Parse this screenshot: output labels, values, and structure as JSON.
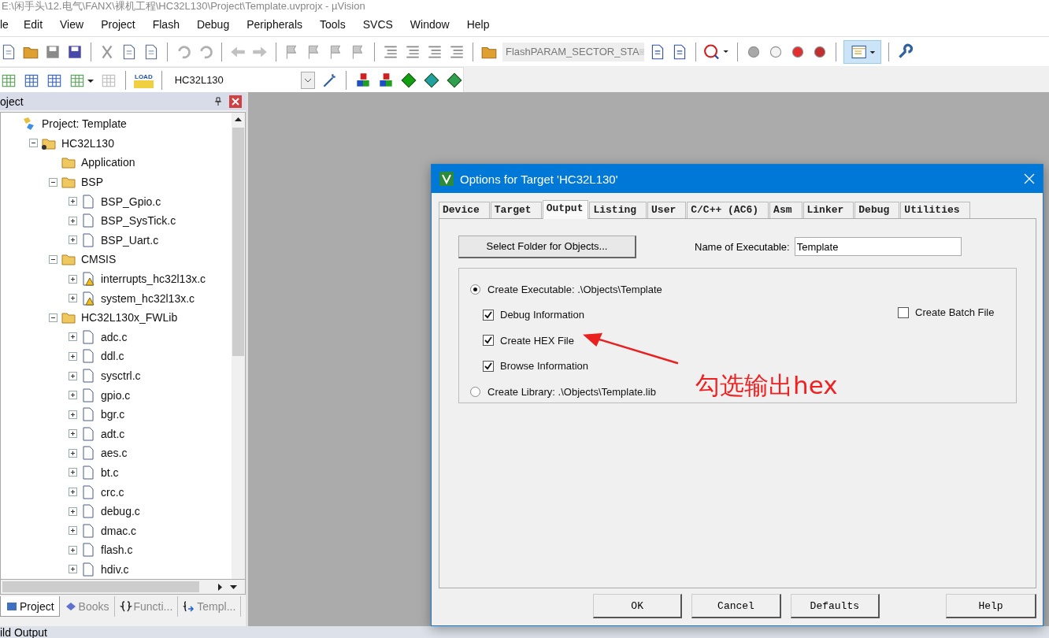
{
  "window": {
    "title": "E:\\闲手头\\12.电气\\FANX\\裸机工程\\HC32L130\\Project\\Template.uvprojx - µVision"
  },
  "menu": [
    "le",
    "Edit",
    "View",
    "Project",
    "Flash",
    "Debug",
    "Peripherals",
    "Tools",
    "SVCS",
    "Window",
    "Help"
  ],
  "toolbar": {
    "flash_combo": "FlashPARAM_SECTOR_STA",
    "load_label": "LOAD",
    "target_combo": "HC32L130"
  },
  "project_panel": {
    "title": "oject",
    "tree": [
      {
        "label": "Project: Template",
        "kind": "project",
        "children": [
          {
            "label": "HC32L130",
            "kind": "target",
            "expanded": true,
            "children": [
              {
                "label": "Application",
                "kind": "folder"
              },
              {
                "label": "BSP",
                "kind": "folder",
                "expanded": true,
                "children": [
                  {
                    "label": "BSP_Gpio.c",
                    "kind": "file",
                    "expanded": false
                  },
                  {
                    "label": "BSP_SysTick.c",
                    "kind": "file",
                    "expanded": false
                  },
                  {
                    "label": "BSP_Uart.c",
                    "kind": "file",
                    "expanded": false
                  }
                ]
              },
              {
                "label": "CMSIS",
                "kind": "folder",
                "expanded": true,
                "children": [
                  {
                    "label": "interrupts_hc32l13x.c",
                    "kind": "warning-file",
                    "expanded": false
                  },
                  {
                    "label": "system_hc32l13x.c",
                    "kind": "warning-file",
                    "expanded": false
                  }
                ]
              },
              {
                "label": "HC32L130x_FWLib",
                "kind": "folder",
                "expanded": true,
                "children": [
                  {
                    "label": "adc.c",
                    "kind": "file",
                    "expanded": false
                  },
                  {
                    "label": "ddl.c",
                    "kind": "file",
                    "expanded": false
                  },
                  {
                    "label": "sysctrl.c",
                    "kind": "file",
                    "expanded": false
                  },
                  {
                    "label": "gpio.c",
                    "kind": "file",
                    "expanded": false
                  },
                  {
                    "label": "bgr.c",
                    "kind": "file",
                    "expanded": false
                  },
                  {
                    "label": "adt.c",
                    "kind": "file",
                    "expanded": false
                  },
                  {
                    "label": "aes.c",
                    "kind": "file",
                    "expanded": false
                  },
                  {
                    "label": "bt.c",
                    "kind": "file",
                    "expanded": false
                  },
                  {
                    "label": "crc.c",
                    "kind": "file",
                    "expanded": false
                  },
                  {
                    "label": "debug.c",
                    "kind": "file",
                    "expanded": false
                  },
                  {
                    "label": "dmac.c",
                    "kind": "file",
                    "expanded": false
                  },
                  {
                    "label": "flash.c",
                    "kind": "file",
                    "expanded": false
                  },
                  {
                    "label": "hdiv.c",
                    "kind": "file",
                    "expanded": false
                  }
                ]
              }
            ]
          }
        ]
      }
    ],
    "tabs": [
      {
        "label": "Project",
        "kind": "project",
        "selected": true
      },
      {
        "label": "Books",
        "kind": "books",
        "selected": false
      },
      {
        "label": "Functi...",
        "kind": "functions",
        "selected": false
      },
      {
        "label": "Templ...",
        "kind": "templates",
        "selected": false
      }
    ]
  },
  "output_panel": {
    "title": "ild Output"
  },
  "dialog": {
    "title": "Options for Target 'HC32L130'",
    "tabs": [
      {
        "label": "Device",
        "selected": false
      },
      {
        "label": "Target",
        "selected": false
      },
      {
        "label": "Output",
        "selected": true
      },
      {
        "label": "Listing",
        "selected": false
      },
      {
        "label": "User",
        "selected": false
      },
      {
        "label": "C/C++ (AC6)",
        "selected": false
      },
      {
        "label": "Asm",
        "selected": false
      },
      {
        "label": "Linker",
        "selected": false
      },
      {
        "label": "Debug",
        "selected": false
      },
      {
        "label": "Utilities",
        "selected": false
      }
    ],
    "select_folder_button": "Select Folder for Objects...",
    "name_label": "Name of Executable:",
    "name_value": "Template",
    "options": [
      {
        "kind": "radio",
        "label": "Create Executable:  .\\Objects\\Template",
        "selected": true
      },
      {
        "kind": "checkbox",
        "label": "Debug Information",
        "checked": true
      },
      {
        "kind": "checkbox",
        "label": "Create HEX File",
        "checked": true
      },
      {
        "kind": "checkbox",
        "label": "Browse Information",
        "checked": true
      },
      {
        "kind": "radio",
        "label": "Create Library:  .\\Objects\\Template.lib",
        "selected": false
      }
    ],
    "batch": {
      "label": "Create Batch File",
      "checked": false
    },
    "buttons": [
      {
        "label": "OK",
        "kind": "main"
      },
      {
        "label": "Cancel",
        "kind": "main"
      },
      {
        "label": "Defaults",
        "kind": "main"
      },
      {
        "label": "Help",
        "kind": "help"
      }
    ]
  },
  "annotation": {
    "text": "勾选输出hex"
  }
}
